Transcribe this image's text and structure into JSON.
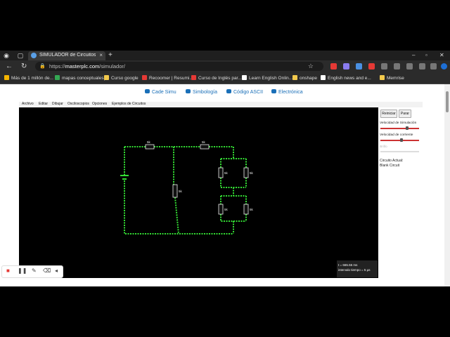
{
  "browser": {
    "tab_title": "SIMULADOR de Circuitos Electró",
    "url_prefix": "https://",
    "url_host": "masterplc.com",
    "url_path": "/simulador/",
    "bookmarks": [
      {
        "label": "Más de 1 millón de...",
        "color": "#f4b400"
      },
      {
        "label": "mapas conceptuales|",
        "color": "#34a853"
      },
      {
        "label": "Curso google",
        "color": "#f2c94c"
      },
      {
        "label": "Recoomer | Resumi...",
        "color": "#e53935"
      },
      {
        "label": "Curso de Inglés par...",
        "color": "#e53935"
      },
      {
        "label": "Learn English Onlin...",
        "color": "#ffffff"
      },
      {
        "label": "onshape",
        "color": "#f2c94c"
      },
      {
        "label": "English news and e...",
        "color": "#ffffff"
      },
      {
        "label": "Memrise",
        "color": "#f2c94c"
      }
    ]
  },
  "site": {
    "nav": [
      {
        "label": "Cade Simu"
      },
      {
        "label": "Simbología"
      },
      {
        "label": "Código ASCII"
      },
      {
        "label": "Electrónica"
      }
    ],
    "menu": [
      "Archivo",
      "Editar",
      "Dibujar",
      "Osciloscopios",
      "Opciones",
      "Ejemplos de Circuitos"
    ]
  },
  "sim": {
    "reset_label": "Reiniciar",
    "stop_label": "Parar",
    "speed_label": "Velocidad de Simulación",
    "current_label": "Velocidad de corriente",
    "power_label": "Brillo",
    "circuit_label": "Circuito Actual:",
    "circuit_name": "Blank Circuit",
    "time_text": "t = 665.55 ms",
    "step_text": "intervalo tiempo = 5 µs",
    "speed_value": 0.7,
    "current_value": 0.55,
    "wire_color": "#33dd33",
    "resistor_labels": [
      "5k",
      "5k",
      "5k",
      "5k",
      "5k",
      "5k",
      "5k"
    ]
  }
}
